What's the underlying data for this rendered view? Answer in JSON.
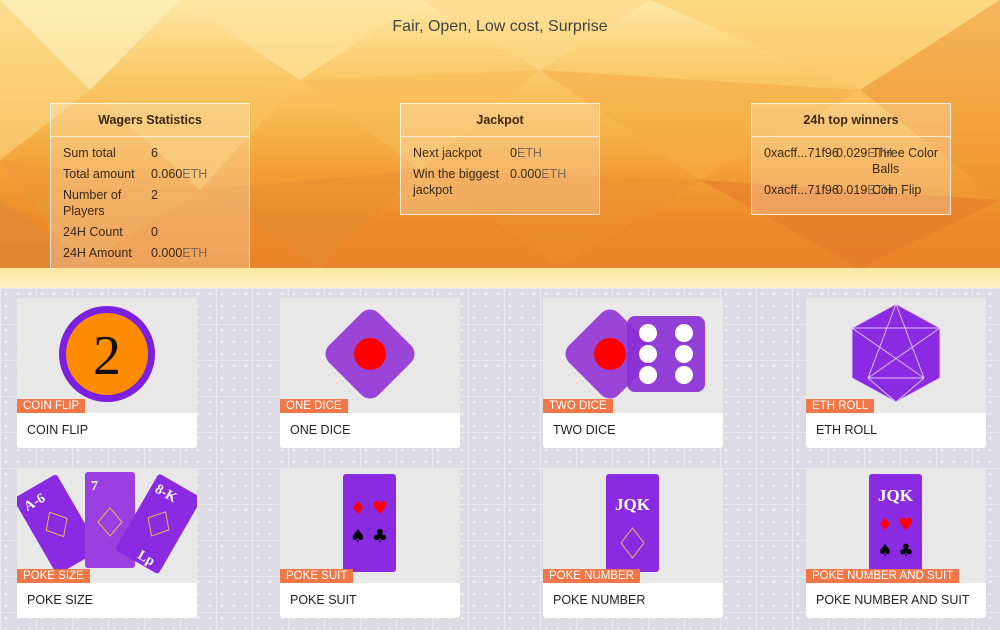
{
  "hero": {
    "tagline": "Fair, Open, Low cost, Surprise"
  },
  "wagers": {
    "title": "Wagers Statistics",
    "rows": [
      {
        "label": "Sum total",
        "value": "6",
        "unit": ""
      },
      {
        "label": "Total amount",
        "value": "0.060",
        "unit": "ETH"
      },
      {
        "label": "Number of Players",
        "value": "2",
        "unit": ""
      },
      {
        "label": "24H Count",
        "value": "0",
        "unit": ""
      },
      {
        "label": "24H Amount",
        "value": "0.000",
        "unit": "ETH"
      }
    ]
  },
  "jackpot": {
    "title": "Jackpot",
    "rows": [
      {
        "label": "Next jackpot",
        "value": "0",
        "unit": "ETH"
      },
      {
        "label": "Win the biggest jackpot",
        "value": "0.000",
        "unit": "ETH"
      }
    ]
  },
  "winners": {
    "title": "24h top winners",
    "rows": [
      {
        "address": "0xacff...71f96",
        "amount": "0.029",
        "unit": "ETH",
        "game": "Three Color Balls"
      },
      {
        "address": "0xacff...71f96",
        "amount": "0.019",
        "unit": "ETH",
        "game": "Coin Flip"
      }
    ]
  },
  "games": [
    {
      "tag": "COIN FLIP",
      "title": "COIN FLIP",
      "coin_number": "2"
    },
    {
      "tag": "ONE DICE",
      "title": "ONE DICE"
    },
    {
      "tag": "TWO DICE",
      "title": "TWO DICE"
    },
    {
      "tag": "ETH ROLL",
      "title": "ETH ROLL"
    },
    {
      "tag": "POKE SIZE",
      "title": "POKE SIZE",
      "card_labels": [
        "A-6",
        "7",
        "8-K",
        "Lp"
      ]
    },
    {
      "tag": "POKE SUIT",
      "title": "POKE SUIT"
    },
    {
      "tag": "POKE NUMBER",
      "title": "POKE NUMBER",
      "card_label": "JQK"
    },
    {
      "tag": "POKE NUMBER AND SUIT",
      "title": "POKE NUMBER AND SUIT",
      "card_label": "JQK"
    }
  ],
  "colors": {
    "purple": "#8a2be2",
    "purple_light": "#a064d8",
    "red": "#ff0000",
    "orange_coin": "#ff8c00",
    "tag_orange": "#f07848"
  },
  "icons": [
    "coin-icon",
    "one-dice-icon",
    "two-dice-icon",
    "eth-roll-icon",
    "poke-size-icon",
    "poke-suit-icon",
    "poke-number-icon",
    "poke-number-suit-icon"
  ]
}
